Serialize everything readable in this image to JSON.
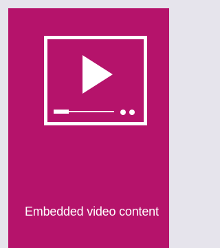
{
  "card": {
    "background_color": "#b5136b",
    "foreground_color": "#ffffff",
    "icon": "video-player-icon",
    "caption": "Embedded video content"
  }
}
